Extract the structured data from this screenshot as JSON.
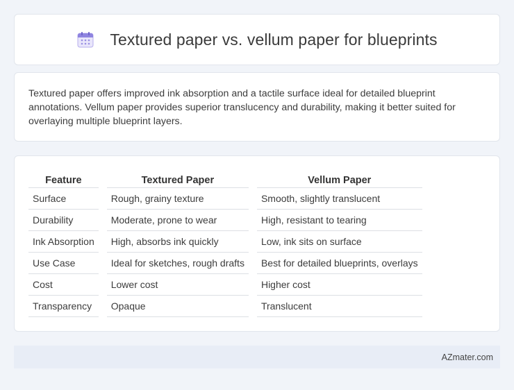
{
  "header": {
    "title": "Textured paper vs. vellum paper for blueprints",
    "icon": "calendar-icon"
  },
  "description": "Textured paper offers improved ink absorption and a tactile surface ideal for detailed blueprint annotations. Vellum paper provides superior translucency and durability, making it better suited for overlaying multiple blueprint layers.",
  "table": {
    "headers": [
      "Feature",
      "Textured Paper",
      "Vellum Paper"
    ],
    "rows": [
      [
        "Surface",
        "Rough, grainy texture",
        "Smooth, slightly translucent"
      ],
      [
        "Durability",
        "Moderate, prone to wear",
        "High, resistant to tearing"
      ],
      [
        "Ink Absorption",
        "High, absorbs ink quickly",
        "Low, ink sits on surface"
      ],
      [
        "Use Case",
        "Ideal for sketches, rough drafts",
        "Best for detailed blueprints, overlays"
      ],
      [
        "Cost",
        "Lower cost",
        "Higher cost"
      ],
      [
        "Transparency",
        "Opaque",
        "Translucent"
      ]
    ]
  },
  "footer": {
    "brand": "AZmater.com"
  },
  "colors": {
    "background": "#f1f4f9",
    "card": "#ffffff",
    "footer": "#e8edf6",
    "icon_accent": "#7b6fd6"
  }
}
